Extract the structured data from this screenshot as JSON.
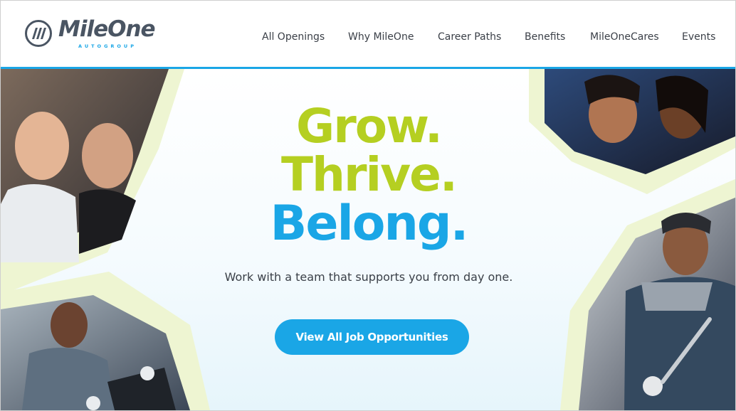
{
  "brand": {
    "name": "MileOne",
    "sub": "AUTOGROUP",
    "icon": "mileone-logo-icon"
  },
  "nav": [
    {
      "label": "All Openings"
    },
    {
      "label": "Why MileOne"
    },
    {
      "label": "Career Paths"
    },
    {
      "label": "Benefits"
    },
    {
      "label": "MileOneCares"
    },
    {
      "label": "Events"
    }
  ],
  "hero": {
    "headline_1": "Grow.",
    "headline_2": "Thrive.",
    "headline_3": "Belong.",
    "subtitle": "Work with a team that supports you from day one.",
    "cta": "View All Job Opportunities"
  },
  "colors": {
    "accent_blue": "#1aa6e6",
    "accent_green": "#b5cf21",
    "frame_green": "#eef5d2",
    "text": "#3a3f47"
  }
}
